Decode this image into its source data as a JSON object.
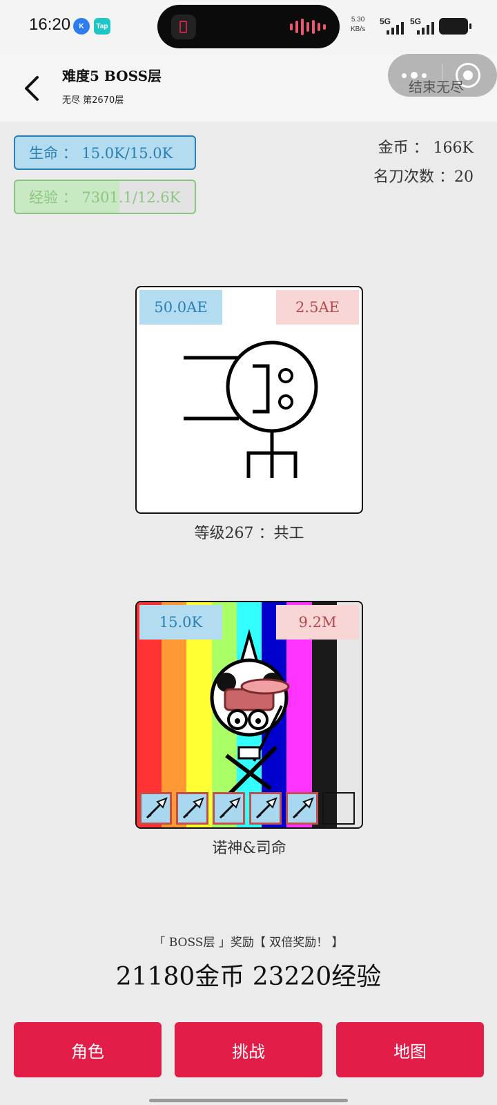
{
  "status_bar": {
    "time": "16:20",
    "app_badge_k": "K",
    "app_badge_tap": "Tap",
    "net_speed": "5.30",
    "net_unit": "KB/s",
    "sim1": "5G",
    "sim2": "5G"
  },
  "header": {
    "title": "难度5 BOSS层",
    "subtitle": "无尽 第2670层",
    "end_label": "结束无尽"
  },
  "player": {
    "hp_text": "生命 ： 15.0K/15.0K",
    "exp_text": "经验 ： 7301.1/12.6K",
    "exp_progress": 0.58,
    "gold_text": "金币 ： 166K",
    "knife_text": "名刀次数 ：20"
  },
  "enemy": {
    "attack": "50.0AE",
    "defense": "2.5AE",
    "caption": "等级267 ：共工"
  },
  "hero": {
    "attack": "15.0K",
    "defense": "9.2M",
    "caption": "诺神&司命",
    "stripe_colors": [
      "#ff3333",
      "#ff9933",
      "#ffff33",
      "#aaff66",
      "#33ffff",
      "#0000cc",
      "#ff33ff",
      "#1a1a1a",
      "#e6e6e6"
    ],
    "slots": [
      "arrow",
      "arrow",
      "arrow",
      "arrow",
      "arrow",
      "empty"
    ]
  },
  "reward": {
    "title": "「 BOSS层 」奖励【 双倍奖励！ 】",
    "amount": "21180金币 23220经验"
  },
  "buttons": {
    "role": "角色",
    "challenge": "挑战",
    "map": "地图"
  },
  "colors": {
    "accent": "#e11d48",
    "hp_blue": "#2a7fb3",
    "exp_green": "#8cc57f",
    "defense_red": "#b5484a"
  }
}
